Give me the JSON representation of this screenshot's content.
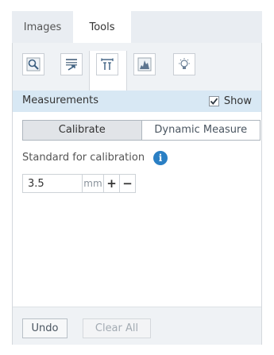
{
  "tabs": [
    {
      "label": "Images",
      "active": false
    },
    {
      "label": "Tools",
      "active": true
    }
  ],
  "toolbar": {
    "tools": [
      {
        "icon": "zoom-icon"
      },
      {
        "icon": "list-export-icon"
      },
      {
        "icon": "measure-ruler-icon",
        "active": true
      },
      {
        "icon": "histogram-icon"
      },
      {
        "icon": "lightbulb-icon"
      }
    ]
  },
  "measurements": {
    "title": "Measurements",
    "show_label": "Show",
    "show_checked": true
  },
  "mode_toggle": {
    "calibrate_label": "Calibrate",
    "dynamic_label": "Dynamic Measure",
    "active": "calibrate"
  },
  "calibration": {
    "label": "Standard for calibration",
    "info_glyph": "i",
    "value": "3.5",
    "unit": "mm",
    "plus": "+",
    "minus": "−"
  },
  "footer": {
    "undo_label": "Undo",
    "clear_all_label": "Clear All"
  },
  "colors": {
    "accent": "#2a7fc4",
    "header_bg": "#d8e8f4"
  }
}
